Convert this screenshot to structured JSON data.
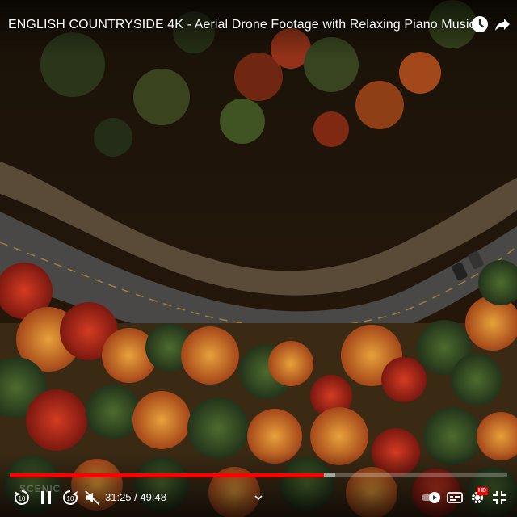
{
  "video": {
    "title": "ENGLISH COUNTRYSIDE 4K - Aerial Drone Footage with Relaxing Piano Music",
    "description_scene": "aerial autumn forest road"
  },
  "top_actions": [
    {
      "name": "watch-later-icon"
    },
    {
      "name": "share-icon"
    }
  ],
  "player": {
    "current_time": "31:25",
    "separator": " / ",
    "duration": "49:48",
    "time_display": "31:25 / 49:48",
    "progress_fraction": 0.631,
    "buffered_fraction": 0.655,
    "accent_color": "#ff0000",
    "watermark": "SCENIC"
  },
  "controls": {
    "rewind_label": "10",
    "forward_label": "10",
    "hd_badge": "HD"
  }
}
